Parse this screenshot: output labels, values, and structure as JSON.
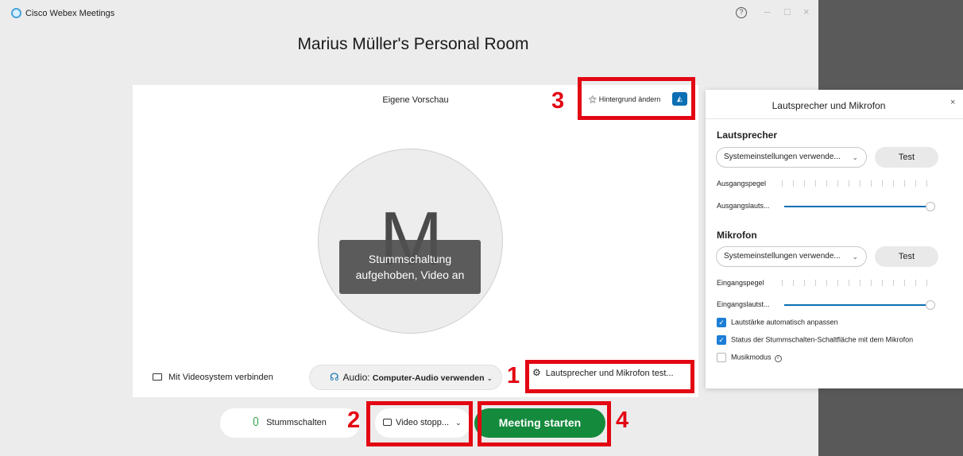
{
  "app": {
    "title": "Cisco Webex Meetings",
    "help_icon": "question-circle-icon"
  },
  "room": {
    "title": "Marius Müller's Personal Room"
  },
  "preview": {
    "label": "Eigene Vorschau",
    "avatar_letter": "M",
    "status_line1": "Stummschaltung",
    "status_line2": "aufgehoben, Video an",
    "background_button": "Hintergrund ändern"
  },
  "connection": {
    "video_system": "Mit Videosystem verbinden",
    "audio_prefix": "Audio: ",
    "audio_value": "Computer-Audio verwenden",
    "speaker_test": "Lautsprecher und Mikrofon test..."
  },
  "controls": {
    "mute": "Stummschalten",
    "video": "Video stopp...",
    "start": "Meeting starten"
  },
  "annotations": {
    "n1": "1",
    "n2": "2",
    "n3": "3",
    "n4": "4",
    "color": "#e30613"
  },
  "panel": {
    "title": "Lautsprecher und Mikrofon",
    "close": "×",
    "speaker": {
      "heading": "Lautsprecher",
      "device": "Systemeinstellungen verwende...",
      "test": "Test",
      "level_label": "Ausgangspegel",
      "volume_label": "Ausgangslauts..."
    },
    "microphone": {
      "heading": "Mikrofon",
      "device": "Systemeinstellungen verwende...",
      "test": "Test",
      "level_label": "Eingangspegel",
      "volume_label": "Eingangslautst..."
    },
    "options": [
      {
        "label": "Lautstärke automatisch anpassen",
        "checked": true
      },
      {
        "label": "Status der Stummschalten-Schaltfläche mit dem Mikrofon",
        "checked": true
      },
      {
        "label": "Musikmodus",
        "checked": false
      }
    ]
  },
  "colors": {
    "accent": "#0b6fb3",
    "start_green": "#148a3c"
  }
}
